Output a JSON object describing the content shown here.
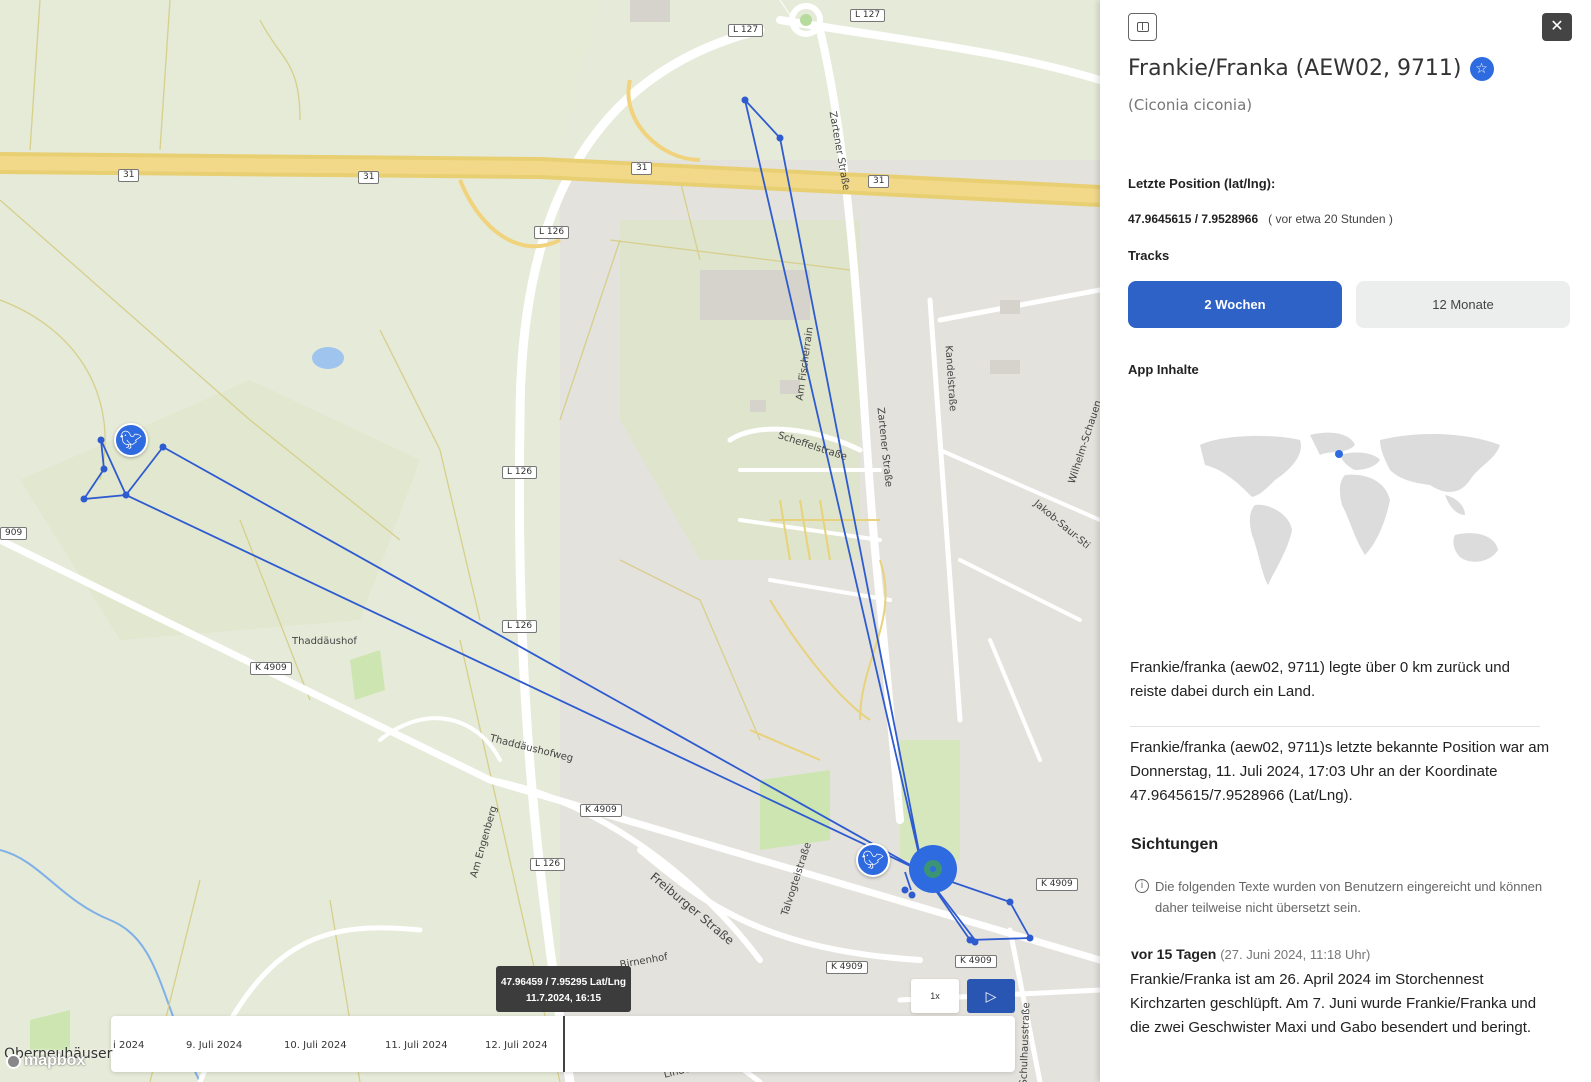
{
  "map": {
    "road_shields": [
      "L 127",
      "L 127",
      "31",
      "31",
      "31",
      "31",
      "L 126",
      "L 126",
      "L 126",
      "L 126",
      "K 4909",
      "K 4909",
      "K 4909",
      "K 4909",
      "K 4909",
      "909"
    ],
    "street_labels": [
      "Zartener Straße",
      "Zartener Straße",
      "Am Fischerrain",
      "Kandelstraße",
      "Scheffelstraße",
      "Wilhelm-Schauen",
      "Jakob-Saur-Sti",
      "Thaddäushofweg",
      "Am Engenberg",
      "Freiburger Straße",
      "Talvogteistraße",
      "Birnenhof",
      "Schulhausstraße",
      "Linden"
    ],
    "places": [
      "Thaddäushof",
      "Oberneuhäuser"
    ],
    "marker_icon": "stork-icon",
    "track_color": "#2e5bd0",
    "tooltip": {
      "coords": "47.96459 / 7.95295 Lat/Lng",
      "time": "11.7.2024, 16:15"
    },
    "timeline": {
      "labels": [
        "i 2024",
        "9. Juli 2024",
        "10. Juli 2024",
        "11. Juli 2024",
        "12. Juli 2024"
      ]
    },
    "speed_label": "1x",
    "play_icon": "play-icon",
    "attribution": "mapbox"
  },
  "panel": {
    "name": "Frankie/Franka (AEW02, 9711)",
    "latin": "(Ciconia ciconia)",
    "last_position_label": "Letzte Position (lat/lng):",
    "last_position_value": "47.9645615 / 7.9528966",
    "last_position_ago": "( vor etwa 20 Stunden )",
    "tracks_label": "Tracks",
    "tracks_buttons": [
      "2 Wochen",
      "12 Monate"
    ],
    "app_content_label": "App Inhalte",
    "summary": "Frankie/franka (aew02, 9711) legte über 0 km zurück und reiste dabei durch ein Land.",
    "last_known": "Frankie/franka (aew02, 9711)s letzte bekannte Position war am Donnerstag, 11. Juli 2024, 17:03 Uhr an der Koordinate 47.9645615/7.9528966 (Lat/Lng).",
    "sightings_label": "Sichtungen",
    "sightings_note": "Die folgenden Texte wurden von Benutzern eingereicht und können daher teilweise nicht übersetzt sein.",
    "sighting_ago": "vor 15 Tagen",
    "sighting_date": "(27. Juni 2024, 11:18 Uhr)",
    "sighting_text": "Frankie/Franka ist am 26. April 2024 im Storchennest Kirchzarten geschlüpft. Am 7. Juni wurde Frankie/Franka und die zwei Geschwister Maxi und Gabo besendert und beringt.",
    "colors": {
      "accent": "#2f62c6",
      "secondary_button": "#eceded"
    }
  }
}
